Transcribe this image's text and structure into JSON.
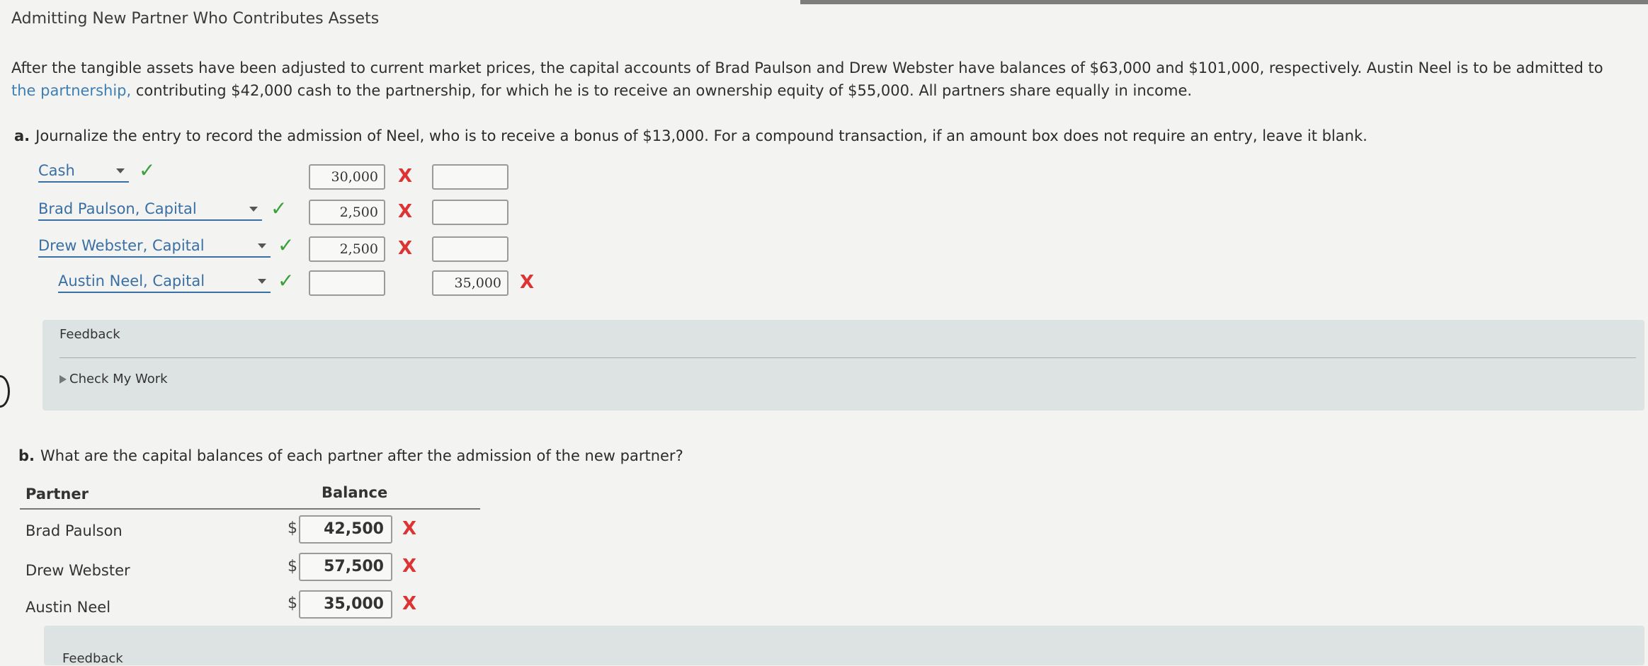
{
  "title": "Admitting New Partner Who Contributes Assets",
  "intro": {
    "line1": "After the tangible assets have been adjusted to current market prices, the capital accounts of Brad Paulson and Drew Webster have balances of $63,000 and $101,000, respectively. Austin Neel is to be admitted to",
    "line2_link": "the partnership,",
    "line2_rest": " contributing $42,000 cash to the partnership, for which he is to receive an ownership equity of $55,000. All partners share equally in income."
  },
  "part_a": {
    "label": "a.",
    "question": "Journalize the entry to record the admission of Neel, who is to receive a bonus of $13,000. For a compound transaction, if an amount box does not require an entry, leave it blank.",
    "rows": [
      {
        "account": "Cash",
        "debit": "30,000",
        "credit": ""
      },
      {
        "account": "Brad Paulson, Capital",
        "debit": "2,500",
        "credit": ""
      },
      {
        "account": "Drew Webster, Capital",
        "debit": "2,500",
        "credit": ""
      },
      {
        "account": "Austin Neel, Capital",
        "debit": "",
        "credit": "35,000"
      }
    ],
    "feedback_label": "Feedback",
    "check_my_work": "Check My Work"
  },
  "part_b": {
    "label": "b.",
    "question": "What are the capital balances of each partner after the admission of the new partner?",
    "col_partner": "Partner",
    "col_balance": "Balance",
    "rows": [
      {
        "partner": "Brad Paulson",
        "currency": "$",
        "balance": "42,500"
      },
      {
        "partner": "Drew Webster",
        "currency": "$",
        "balance": "57,500"
      },
      {
        "partner": "Austin Neel",
        "currency": "$",
        "balance": "35,000"
      }
    ],
    "feedback_label": "Feedback"
  },
  "marks": {
    "correct": "✓",
    "incorrect": "X"
  },
  "colors": {
    "correct": "#3aa03a",
    "incorrect": "#dd3333",
    "link": "#3d7fb5",
    "feedback_bg": "#dde2e3"
  }
}
